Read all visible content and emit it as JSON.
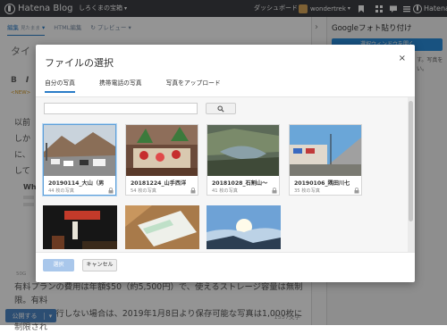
{
  "topbar": {
    "logo": "Hatena Blog",
    "blog_name": "しろくまの宝箱",
    "dashboard": "ダッシュボード",
    "username": "wondertrek",
    "hatena": "Hatena"
  },
  "editor": {
    "tab_edit": "編集",
    "tab_edit_sub": "見たまま",
    "tab_html": "HTML編集",
    "tab_preview": "プレビュー",
    "title_placeholder": "タイ",
    "fmt_bold": "B",
    "fmt_italic": "I",
    "new_tag": "<NEW>",
    "text_line1": "以前",
    "text_line2": "しか",
    "text_line3": "に、",
    "text_line4": "して",
    "card_title": "Wh",
    "sub_meta": "50G",
    "body_line1": "有料プランの費用は年額$50（約5,500円）で、使えるストレージ容量は無制限。有料",
    "body_line2": "プランへ移行しない場合は、2019年1月8日より保存可能な写真は1,000枚に制限され",
    "publish": "公開する",
    "char_count": "1557文字"
  },
  "sidebar": {
    "title": "Googleフォト貼り付け",
    "button": "選択ウィンドウを開く",
    "note1": "す。写真を",
    "note2": "い。"
  },
  "modal": {
    "title": "ファイルの選択",
    "close": "×",
    "tabs": [
      "自分の写真",
      "携帯電話の写真",
      "写真をアップロード"
    ],
    "search_placeholder": "",
    "select_button": "選択",
    "cancel_button": "キャンセル",
    "albums": [
      {
        "name": "20190114_大山（男…",
        "count": "44 枚の写真"
      },
      {
        "name": "20181224_山手西洋…",
        "count": "54 枚の写真"
      },
      {
        "name": "20181028_石割山～…",
        "count": "41 枚の写真"
      },
      {
        "name": "20190106_隅田川七…",
        "count": "35 枚の写真"
      }
    ]
  },
  "colors": {
    "accent": "#2a7cc7",
    "topbar": "#3d3f44",
    "select_disabled": "#a9c7eb"
  }
}
